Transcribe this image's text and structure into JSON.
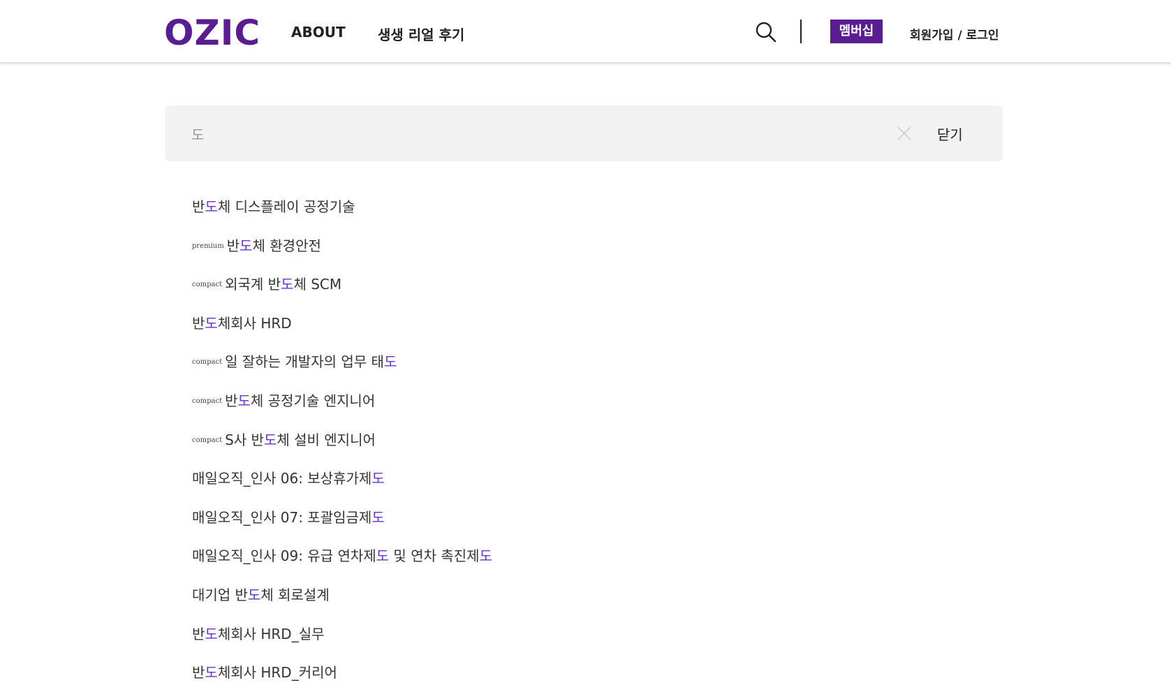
{
  "colors": {
    "brand": "#5a1d91",
    "highlight": "#6a2fd8",
    "search_bg": "#f2f2f2"
  },
  "header": {
    "logo": "OZIC",
    "nav": [
      "ABOUT",
      "생생 리얼 후기"
    ],
    "search_icon": "search-icon",
    "membership": "멤버십",
    "auth": "회원가입 / 로그인"
  },
  "search": {
    "value": "도",
    "clear_icon": "close-x-icon",
    "close_label": "닫기"
  },
  "results": [
    {
      "tag": "",
      "parts": [
        "반",
        "도",
        "체 디스플레이 공정기술"
      ]
    },
    {
      "tag": "premium",
      "parts": [
        "반",
        "도",
        "체 환경안전"
      ]
    },
    {
      "tag": "compact",
      "parts": [
        "외국계 반",
        "도",
        "체 SCM"
      ]
    },
    {
      "tag": "",
      "parts": [
        "반",
        "도",
        "체회사 HRD"
      ]
    },
    {
      "tag": "compact",
      "parts": [
        "일 잘하는 개발자의 업무 태",
        "도",
        ""
      ]
    },
    {
      "tag": "compact",
      "parts": [
        "반",
        "도",
        "체 공정기술 엔지니어"
      ]
    },
    {
      "tag": "compact",
      "parts": [
        "S사 반",
        "도",
        "체 설비 엔지니어"
      ]
    },
    {
      "tag": "",
      "parts": [
        "매일오직_인사 06: 보상휴가제",
        "도",
        ""
      ]
    },
    {
      "tag": "",
      "parts": [
        "매일오직_인사 07: 포괄임금제",
        "도",
        ""
      ]
    },
    {
      "tag": "",
      "parts": [
        "매일오직_인사 09: 유급 연차제",
        "도",
        " 및 연차 촉진제",
        "도",
        ""
      ]
    },
    {
      "tag": "",
      "parts": [
        "대기업 반",
        "도",
        "체 회로설계"
      ]
    },
    {
      "tag": "",
      "parts": [
        "반",
        "도",
        "체회사 HRD_실무"
      ]
    },
    {
      "tag": "",
      "parts": [
        "반",
        "도",
        "체회사 HRD_커리어"
      ]
    }
  ]
}
